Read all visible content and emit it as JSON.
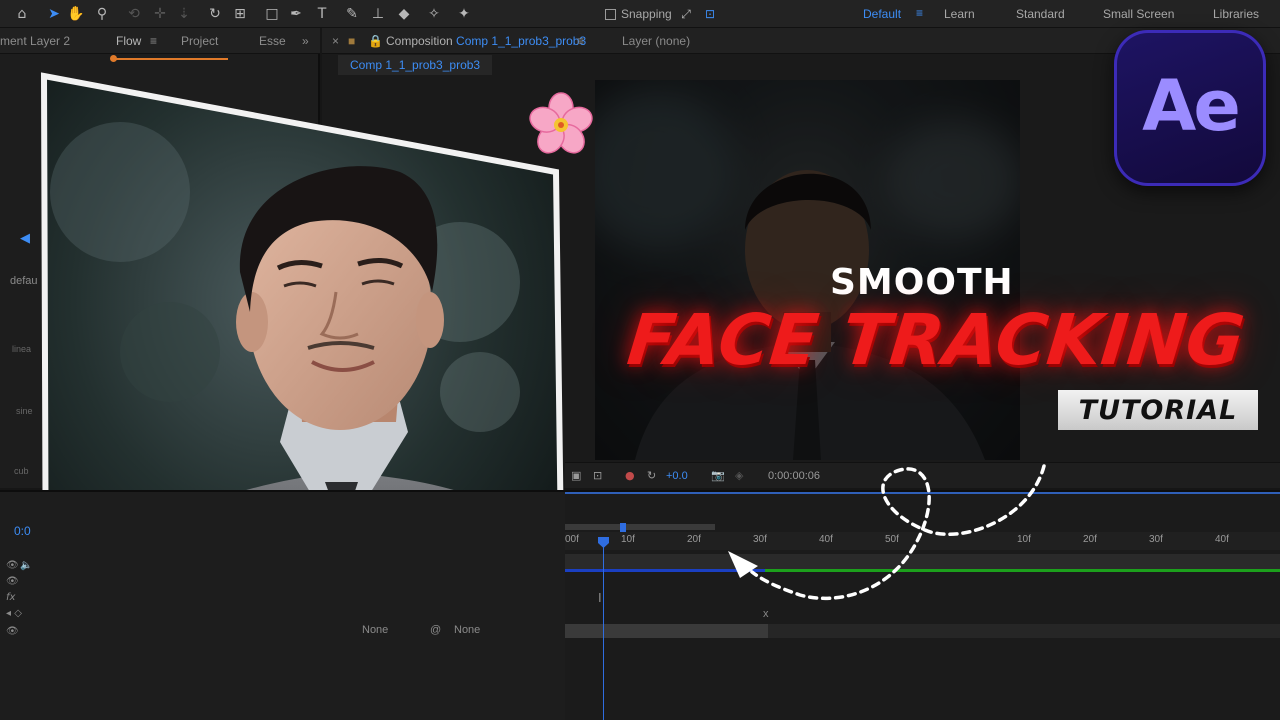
{
  "toolbar": {
    "tool_icons": [
      "home-icon",
      "selection-arrow-icon",
      "hand-icon",
      "zoom-icon",
      "orbit-camera-icon",
      "pan-camera-icon",
      "dolly-camera-icon",
      "rotate-icon",
      "anchor-point-icon",
      "rectangle-icon",
      "pen-icon",
      "type-icon",
      "brush-icon",
      "clone-stamp-icon",
      "eraser-icon",
      "roto-brush-icon",
      "puppet-pin-icon"
    ],
    "snapping_label": "Snapping",
    "workspaces": [
      "Default",
      "Learn",
      "Standard",
      "Small Screen",
      "Libraries"
    ],
    "active_workspace": "Default"
  },
  "left_panel": {
    "tabs": [
      "ment Layer 2",
      "Flow",
      "Project",
      "Esse"
    ],
    "active_tab": "Flow",
    "side_labels": [
      "defau",
      "linea",
      "sine",
      "cub"
    ]
  },
  "comp_panel": {
    "tab_prefix": "Composition",
    "comp_name": "Comp 1_1_prob3_prob3",
    "layer_label": "Layer",
    "layer_value": "(none)",
    "subtab": "Comp 1_1_prob3_prob3",
    "footer": {
      "exposure": "+0.0",
      "timecode": "0:00:00:06"
    }
  },
  "title": {
    "line1": "SMOOTH",
    "line2": "FACE TRACKING",
    "badge": "TUTORIAL"
  },
  "ae_logo_text": "Ae",
  "timeline": {
    "current_time": "0:0",
    "ruler_ticks": [
      "00f",
      "10f",
      "20f",
      "30f",
      "40f",
      "50f",
      "",
      "10f",
      "20f",
      "30f",
      "40f"
    ],
    "blend_labels": [
      "None",
      "None"
    ]
  },
  "colors": {
    "accent_blue": "#3d8df5",
    "flow_orange": "#e07a2a",
    "title_red": "#ee1b1b",
    "ae_purple": "#9b8cff",
    "track_green": "#1ca01c"
  }
}
